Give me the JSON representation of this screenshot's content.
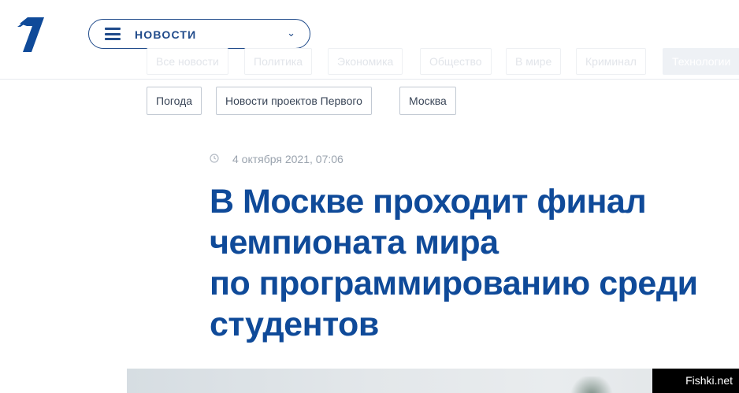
{
  "header": {
    "nav_label": "НОВОСТИ",
    "logo_icon": "channel-one-logo-icon",
    "menu_icon": "hamburger-menu-icon",
    "chevron_icon": "chevron-down-icon",
    "chevron_glyph": "⌄"
  },
  "categories": [
    {
      "label": "Все новости"
    },
    {
      "label": "Политика"
    },
    {
      "label": "Экономика"
    },
    {
      "label": "Общество"
    },
    {
      "label": "В мире"
    },
    {
      "label": "Криминал"
    },
    {
      "label": "Технологии"
    }
  ],
  "tags": [
    {
      "label": "Погода"
    },
    {
      "label": "Новости проектов Первого"
    },
    {
      "label": "Москва"
    }
  ],
  "article": {
    "date": "4 октября 2021, 07:06",
    "headline_lines": [
      "В Москве проходит финал",
      "чемпионата мира",
      "по программированию среди",
      "студентов"
    ]
  },
  "watermark": "Fishki.net",
  "colors": {
    "brand_blue": "#0f4a99",
    "nav_blue": "#1f4a8a",
    "date_gray": "#9aa3ae"
  }
}
